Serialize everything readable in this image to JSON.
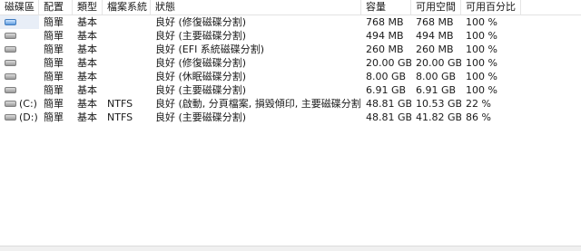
{
  "columns": [
    "磁碟區",
    "配置",
    "類型",
    "檔案系統",
    "狀態",
    "容量",
    "可用空間",
    "可用百分比"
  ],
  "rows": [
    {
      "volume": "",
      "layout": "簡單",
      "type": "基本",
      "fs": "",
      "status": "良好 (修復磁碟分割)",
      "capacity": "768 MB",
      "free": "768 MB",
      "pct": "100 %",
      "icon": "system-disk-icon"
    },
    {
      "volume": "",
      "layout": "簡單",
      "type": "基本",
      "fs": "",
      "status": "良好 (主要磁碟分割)",
      "capacity": "494 MB",
      "free": "494 MB",
      "pct": "100 %",
      "icon": "disk-icon"
    },
    {
      "volume": "",
      "layout": "簡單",
      "type": "基本",
      "fs": "",
      "status": "良好 (EFI 系統磁碟分割)",
      "capacity": "260 MB",
      "free": "260 MB",
      "pct": "100 %",
      "icon": "disk-icon"
    },
    {
      "volume": "",
      "layout": "簡單",
      "type": "基本",
      "fs": "",
      "status": "良好 (修復磁碟分割)",
      "capacity": "20.00 GB",
      "free": "20.00 GB",
      "pct": "100 %",
      "icon": "disk-icon"
    },
    {
      "volume": "",
      "layout": "簡單",
      "type": "基本",
      "fs": "",
      "status": "良好 (休眠磁碟分割)",
      "capacity": "8.00 GB",
      "free": "8.00 GB",
      "pct": "100 %",
      "icon": "disk-icon"
    },
    {
      "volume": "",
      "layout": "簡單",
      "type": "基本",
      "fs": "",
      "status": "良好 (主要磁碟分割)",
      "capacity": "6.91 GB",
      "free": "6.91 GB",
      "pct": "100 %",
      "icon": "disk-icon"
    },
    {
      "volume": "(C:)",
      "layout": "簡單",
      "type": "基本",
      "fs": "NTFS",
      "status": "良好 (啟動, 分頁檔案, 損毀傾印, 主要磁碟分割)",
      "capacity": "48.81 GB",
      "free": "10.53 GB",
      "pct": "22 %",
      "icon": "disk-icon"
    },
    {
      "volume": "(D:)",
      "layout": "簡單",
      "type": "基本",
      "fs": "NTFS",
      "status": "良好 (主要磁碟分割)",
      "capacity": "48.81 GB",
      "free": "41.82 GB",
      "pct": "86 %",
      "icon": "disk-icon"
    }
  ]
}
